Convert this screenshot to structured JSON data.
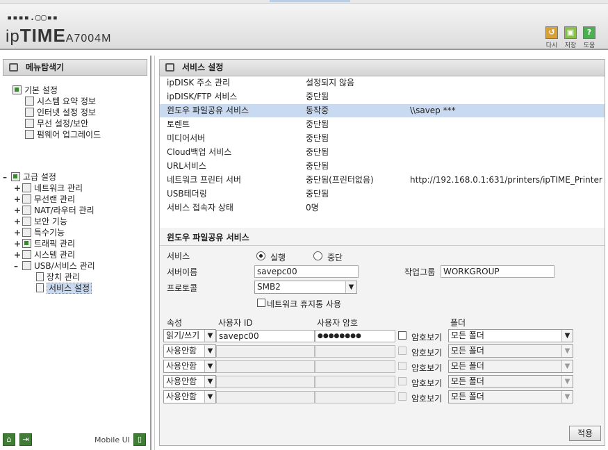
{
  "header": {
    "logo_dots": "▪▪▪▪.▢▢▪▪",
    "brand_prefix": "ip",
    "brand_bold": "TIME",
    "model": "A7004M",
    "buttons": [
      {
        "label": "다시",
        "icon": "refresh-icon",
        "color": "#d9a133"
      },
      {
        "label": "저장",
        "icon": "save-icon",
        "color": "#7cb342"
      },
      {
        "label": "도움",
        "icon": "help-icon",
        "color": "#4caf50"
      }
    ]
  },
  "sidebar": {
    "title": "메뉴탐색기",
    "basic": {
      "label": "기본 설정",
      "items": [
        "시스템 요약 정보",
        "인터넷 설정 정보",
        "무선 설정/보안",
        "펌웨어 업그레이드"
      ]
    },
    "advanced": {
      "label": "고급 설정",
      "items": [
        "네트워크 관리",
        "무선랜 관리",
        "NAT/라우터 관리",
        "보안 기능",
        "특수기능",
        "트래픽 관리",
        "시스템 관리",
        "USB/서비스 관리"
      ],
      "usb_children": [
        "장치 관리",
        "서비스 설정"
      ]
    },
    "footer": {
      "mobile_label": "Mobile UI"
    }
  },
  "main": {
    "title": "서비스 설정",
    "services": [
      {
        "name": "ipDISK 주소 관리",
        "status": "설정되지 않음",
        "extra": ""
      },
      {
        "name": "ipDISK/FTP 서비스",
        "status": "중단됨",
        "extra": ""
      },
      {
        "name": "윈도우 파일공유 서비스",
        "status": "동작중",
        "extra": "\\\\savep ***"
      },
      {
        "name": "토렌트",
        "status": "중단됨",
        "extra": ""
      },
      {
        "name": "미디어서버",
        "status": "중단됨",
        "extra": ""
      },
      {
        "name": "Cloud백업 서비스",
        "status": "중단됨",
        "extra": ""
      },
      {
        "name": "URL서비스",
        "status": "중단됨",
        "extra": ""
      },
      {
        "name": "네트워크 프린터 서버",
        "status": "중단됨(프린터없음)",
        "extra": "http://192.168.0.1:631/printers/ipTIME_Printer"
      },
      {
        "name": "USB테더링",
        "status": "중단됨",
        "extra": ""
      },
      {
        "name": "서비스 접속자 상태",
        "status": "0명",
        "extra": ""
      }
    ],
    "share": {
      "section_title": "윈도우 파일공유 서비스",
      "service_label": "서비스",
      "run_label": "실행",
      "stop_label": "중단",
      "server_name_label": "서버이름",
      "server_name": "savepc00",
      "workgroup_label": "작업그룹",
      "workgroup": "WORKGROUP",
      "protocol_label": "프로토콜",
      "protocol": "SMB2",
      "trash_label": "네트워크 휴지통 사용",
      "headers": {
        "attr": "속성",
        "user": "사용자 ID",
        "pass": "사용자 암호",
        "folder": "폴더"
      },
      "show_pw_label": "암호보기",
      "accounts": [
        {
          "attr": "읽기/쓰기",
          "user": "savepc00",
          "pass": "●●●●●●●●",
          "folder": "모든 폴더"
        },
        {
          "attr": "사용안함",
          "user": "",
          "pass": "",
          "folder": "모든 폴더"
        },
        {
          "attr": "사용안함",
          "user": "",
          "pass": "",
          "folder": "모든 폴더"
        },
        {
          "attr": "사용안함",
          "user": "",
          "pass": "",
          "folder": "모든 폴더"
        },
        {
          "attr": "사용안함",
          "user": "",
          "pass": "",
          "folder": "모든 폴더"
        }
      ]
    },
    "apply_label": "적용"
  }
}
